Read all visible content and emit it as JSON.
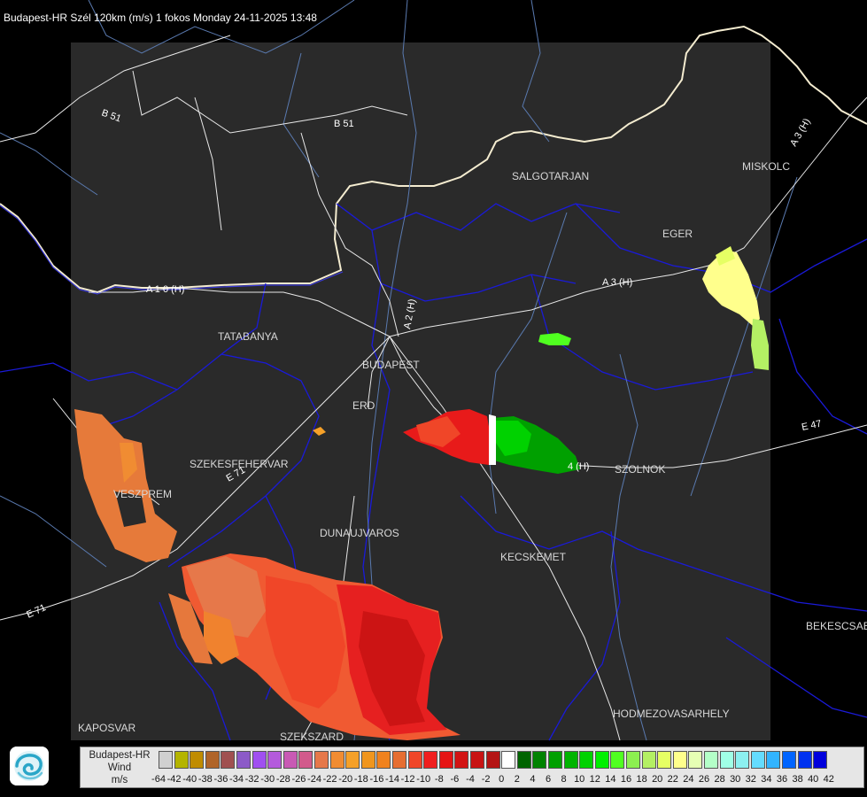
{
  "title": "Budapest-HR Szél 120km (m/s) 1 fokos Monday 24-11-2025 13:48",
  "cities": [
    {
      "name": "SALGOTARJAN"
    },
    {
      "name": "MISKOLC"
    },
    {
      "name": "EGER"
    },
    {
      "name": "TATABANYA"
    },
    {
      "name": "BUDAPEST"
    },
    {
      "name": "ERD"
    },
    {
      "name": "SZEKESFEHERVAR"
    },
    {
      "name": "VESZPREM"
    },
    {
      "name": "DUNAUJVAROS"
    },
    {
      "name": "KECSKEMET"
    },
    {
      "name": "SZOLNOK"
    },
    {
      "name": "BEKESCSABA"
    },
    {
      "name": "HODMEZOVASARHELY"
    },
    {
      "name": "KAPOSVAR"
    },
    {
      "name": "SZEKSZARD"
    }
  ],
  "roads": [
    {
      "name": "B 51"
    },
    {
      "name": "B 51"
    },
    {
      "name": "A 3 (H)"
    },
    {
      "name": "A 3 (H)"
    },
    {
      "name": "A 1 0 (H)"
    },
    {
      "name": "A 2 (H)"
    },
    {
      "name": "E 71"
    },
    {
      "name": "E 71"
    },
    {
      "name": "E 47"
    },
    {
      "name": "4 (H)"
    }
  ],
  "legend": {
    "line1": "Budapest-HR",
    "line2": "Wind",
    "line3": "m/s",
    "colors": [
      "#d0d0d0",
      "#b4b400",
      "#c08c00",
      "#b06428",
      "#a05050",
      "#8c5ac8",
      "#a050f0",
      "#b45adc",
      "#c85ab4",
      "#d25a8c",
      "#e6784a",
      "#f08c32",
      "#f5a028",
      "#f0961e",
      "#f0821e",
      "#e66e32",
      "#f04628",
      "#f01e1e",
      "#e61414",
      "#d21414",
      "#c81414",
      "#b41414",
      "#ffffff",
      "#006400",
      "#008200",
      "#00a000",
      "#00b400",
      "#00d200",
      "#00f000",
      "#50ff20",
      "#8cf050",
      "#b4f064",
      "#e6ff64",
      "#ffff8c",
      "#e6ffb4",
      "#b4ffc8",
      "#a0ffe6",
      "#8cf0f0",
      "#64dcff",
      "#32b4ff",
      "#0064ff",
      "#0032f0",
      "#0000dc"
    ],
    "ticks": [
      "-64",
      "-42",
      "-40",
      "-38",
      "-36",
      "-34",
      "-32",
      "-30",
      "-28",
      "-26",
      "-24",
      "-22",
      "-20",
      "-18",
      "-16",
      "-14",
      "-12",
      "-10",
      "-8",
      "-6",
      "-4",
      "-2",
      "0",
      "2",
      "4",
      "6",
      "8",
      "10",
      "12",
      "14",
      "16",
      "18",
      "20",
      "22",
      "24",
      "26",
      "28",
      "30",
      "32",
      "34",
      "36",
      "38",
      "40",
      "42"
    ]
  }
}
